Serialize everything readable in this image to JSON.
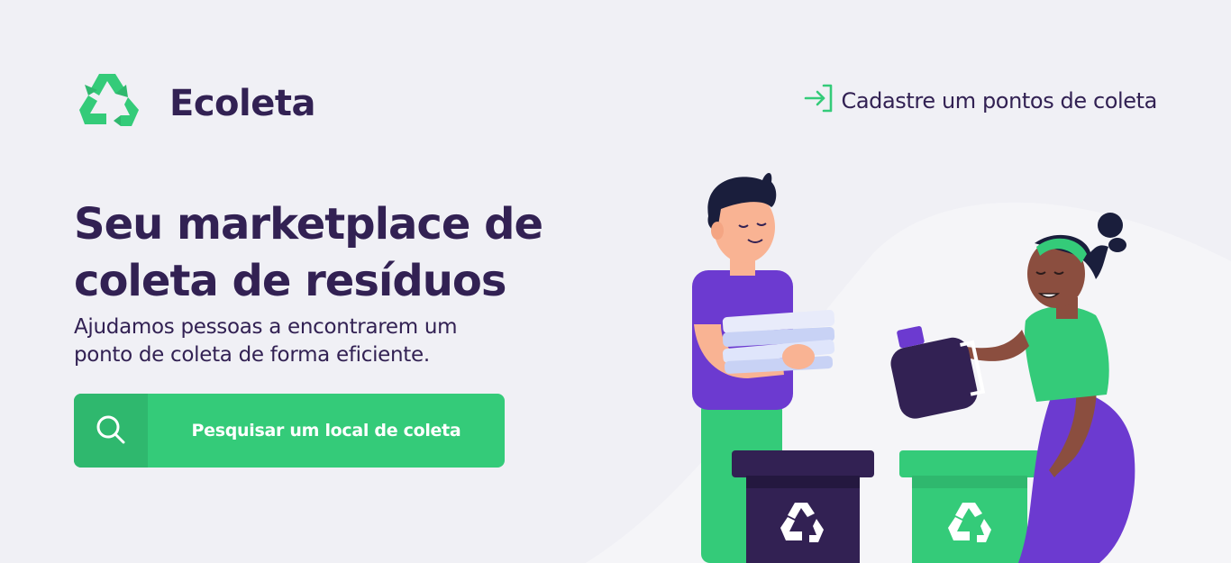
{
  "header": {
    "brand_name": "Ecoleta",
    "logo_icon": "recycle-icon",
    "register_link": "Cadastre um pontos de coleta",
    "register_icon": "log-in-icon"
  },
  "hero": {
    "title_line1": "Seu marketplace de",
    "title_line2": "coleta de resíduos",
    "description": "Ajudamos pessoas a encontrarem um ponto de coleta de forma eficiente."
  },
  "search": {
    "button_label": "Pesquisar um local de coleta",
    "icon": "search-icon"
  },
  "colors": {
    "background": "#f0f0f5",
    "primary": "#34cb79",
    "primary_dark": "#2fb86e",
    "title": "#322153",
    "purple": "#6c3ad0"
  }
}
